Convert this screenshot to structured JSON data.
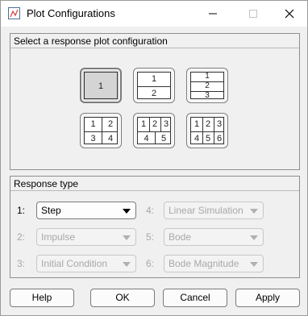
{
  "window": {
    "title": "Plot Configurations"
  },
  "configPanel": {
    "title": "Select a response plot configuration",
    "layouts": [
      {
        "id": "1",
        "cells": [
          "1"
        ],
        "selected": true
      },
      {
        "id": "2",
        "cells": [
          "1",
          "2"
        ],
        "selected": false
      },
      {
        "id": "3",
        "cells": [
          "1",
          "2",
          "3"
        ],
        "selected": false
      },
      {
        "id": "4",
        "cells": [
          "1",
          "2",
          "3",
          "4"
        ],
        "selected": false
      },
      {
        "id": "5",
        "cells": [
          "1",
          "2",
          "3",
          "4",
          "5"
        ],
        "selected": false
      },
      {
        "id": "6",
        "cells": [
          "1",
          "2",
          "3",
          "4",
          "5",
          "6"
        ],
        "selected": false
      }
    ]
  },
  "responsePanel": {
    "title": "Response type",
    "rows": [
      {
        "label": "1:",
        "value": "Step",
        "enabled": true
      },
      {
        "label": "2:",
        "value": "Impulse",
        "enabled": false
      },
      {
        "label": "3:",
        "value": "Initial Condition",
        "enabled": false
      },
      {
        "label": "4:",
        "value": "Linear Simulation",
        "enabled": false
      },
      {
        "label": "5:",
        "value": "Bode",
        "enabled": false
      },
      {
        "label": "6:",
        "value": "Bode Magnitude",
        "enabled": false
      }
    ]
  },
  "buttons": {
    "help": "Help",
    "ok": "OK",
    "cancel": "Cancel",
    "apply": "Apply"
  }
}
